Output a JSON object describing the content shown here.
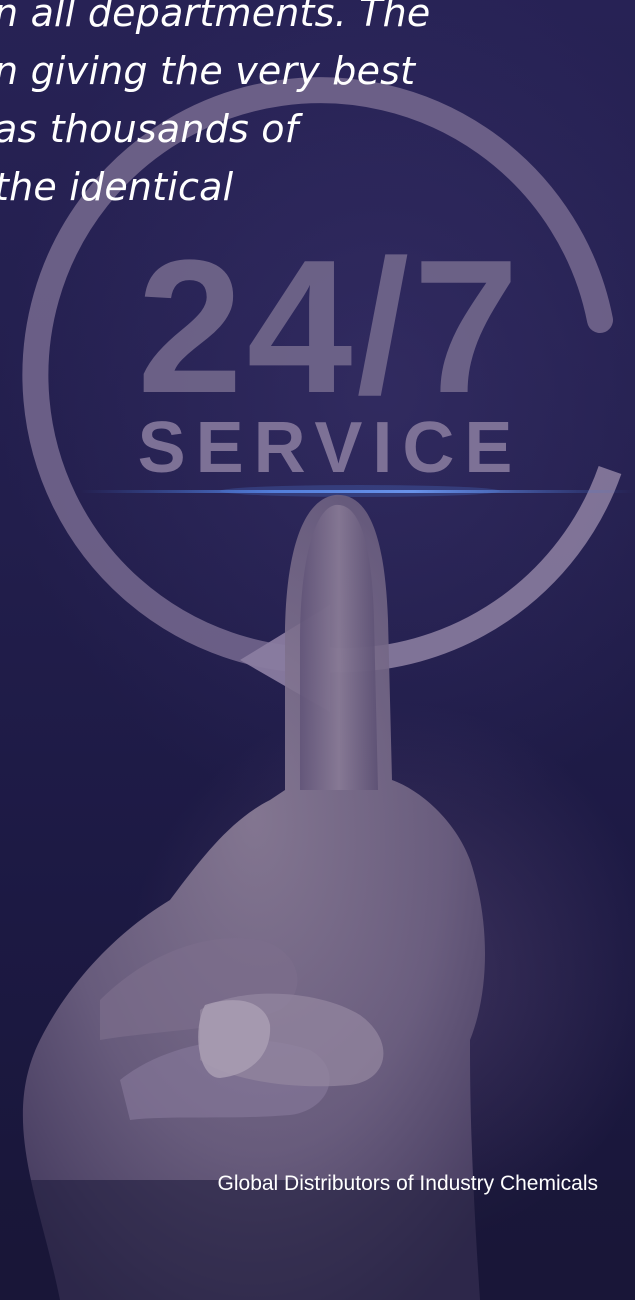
{
  "hero": {
    "quote_lines": [
      "n all departments. The",
      "n giving the very best",
      " as thousands of",
      "the identical"
    ],
    "graphic": {
      "big_text": "24/7",
      "small_text": "SERVICE",
      "icon": "circular-arrow-icon",
      "image_subject": "hand-pointing-finger-photo"
    },
    "tagline": "Global Distributors of Industry Chemicals"
  },
  "colors": {
    "background": "#221e4c",
    "graphic": "#7b6c93",
    "text": "#ffffff",
    "glow": "#3a6fd0"
  }
}
